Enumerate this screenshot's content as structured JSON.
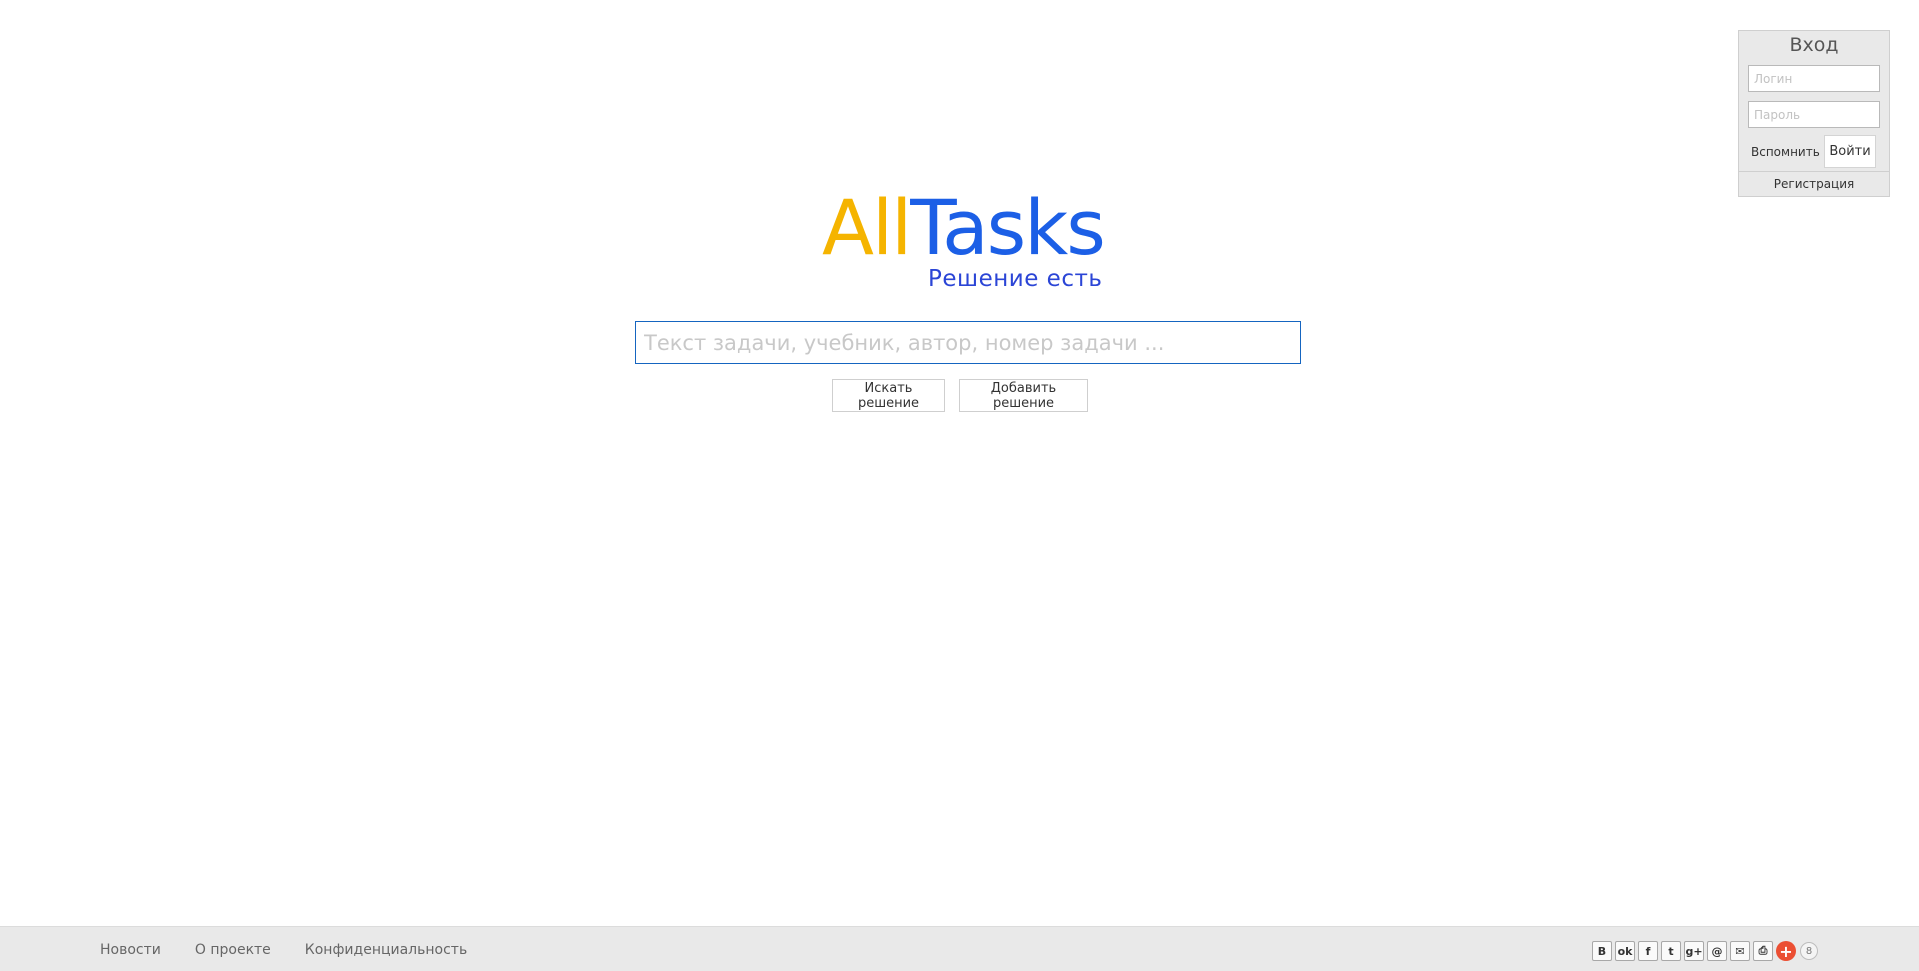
{
  "login": {
    "title": "Вход",
    "login_placeholder": "Логин",
    "password_placeholder": "Пароль",
    "remind_label": "Вспомнить",
    "enter_label": "Войти",
    "register_label": "Регистрация"
  },
  "logo": {
    "part1": "All",
    "part2": "Tasks",
    "tagline": "Решение есть",
    "colors": {
      "all": "#f5b400",
      "tasks": "#1c5fe6",
      "tagline": "#2b45d6"
    }
  },
  "search": {
    "placeholder": "Текст задачи, учебник, автор, номер задачи ...",
    "search_button": "Искать решение",
    "add_button": "Добавить решение"
  },
  "footer": {
    "links": [
      "Новости",
      "О проекте",
      "Конфиденциальность"
    ],
    "share": {
      "icons": [
        {
          "name": "vk-icon",
          "glyph": "B"
        },
        {
          "name": "odnoklassniki-icon",
          "glyph": "ok"
        },
        {
          "name": "facebook-icon",
          "glyph": "f"
        },
        {
          "name": "twitter-icon",
          "glyph": "t"
        },
        {
          "name": "google-plus-icon",
          "glyph": "g+"
        },
        {
          "name": "mail-ru-icon",
          "glyph": "@"
        },
        {
          "name": "email-icon",
          "glyph": "✉"
        },
        {
          "name": "print-icon",
          "glyph": "⎙"
        }
      ],
      "plus_glyph": "+",
      "count": "8"
    }
  }
}
